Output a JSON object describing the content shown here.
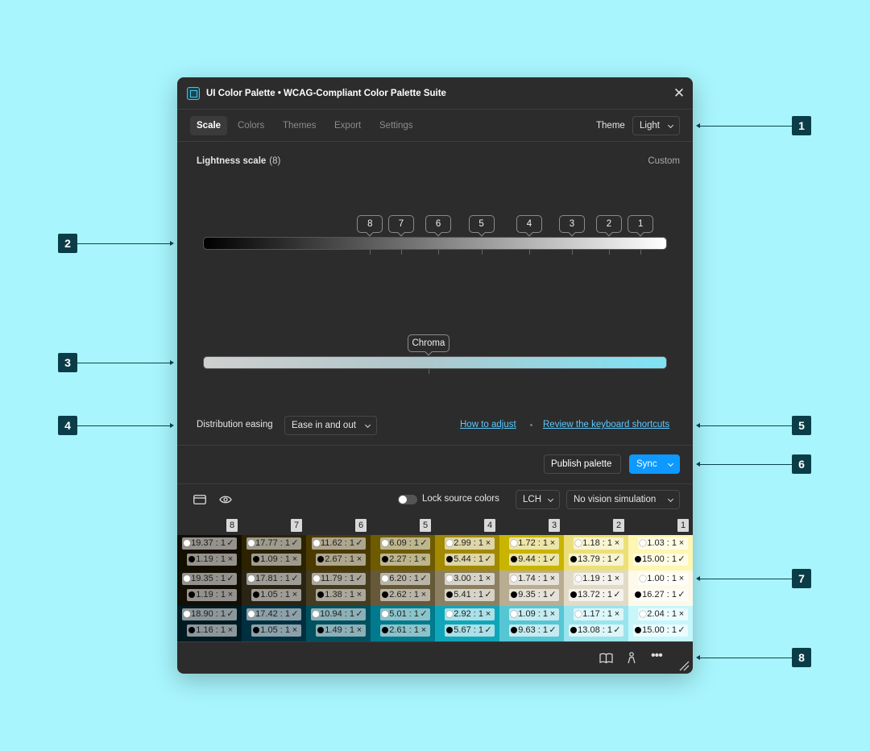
{
  "window": {
    "title": "UI Color Palette • WCAG-Compliant Color Palette Suite"
  },
  "tabs": [
    "Scale",
    "Colors",
    "Themes",
    "Export",
    "Settings"
  ],
  "theme": {
    "label": "Theme",
    "value": "Light"
  },
  "scale": {
    "title": "Lightness scale",
    "count": "(8)",
    "mode": "Custom",
    "stops": [
      {
        "label": "8",
        "lightness_pct": 36
      },
      {
        "label": "7",
        "lightness_pct": 42.7
      },
      {
        "label": "6",
        "lightness_pct": 50.7
      },
      {
        "label": "5",
        "lightness_pct": 60
      },
      {
        "label": "4",
        "lightness_pct": 70.3
      },
      {
        "label": "3",
        "lightness_pct": 79.5
      },
      {
        "label": "2",
        "lightness_pct": 87.5
      },
      {
        "label": "1",
        "lightness_pct": 94.3
      }
    ],
    "chroma_label": "Chroma",
    "chroma_pct": 48.6
  },
  "easing": {
    "label": "Distribution easing",
    "value": "Ease in and out"
  },
  "links": {
    "how_to_adjust": "How to adjust",
    "shortcuts": "Review the keyboard shortcuts"
  },
  "actions": {
    "publish": "Publish palette",
    "sync": "Sync"
  },
  "toolbar": {
    "lock_label": "Lock source colors",
    "color_space": "LCH",
    "vision": "No vision simulation"
  },
  "palette": {
    "columns": [
      "8",
      "7",
      "6",
      "5",
      "4",
      "3",
      "2",
      "1"
    ],
    "rows": [
      {
        "colors": [
          "#140e00",
          "#2b2200",
          "#4a3a00",
          "#6e5b00",
          "#a28900",
          "#c9b400",
          "#ecdf7a",
          "#fef6b3"
        ],
        "white": [
          [
            "19.37 : 1",
            "pass"
          ],
          [
            "17.77 : 1",
            "pass"
          ],
          [
            "11.62 : 1",
            "pass"
          ],
          [
            "6.09 : 1",
            "pass"
          ],
          [
            "2.99 : 1",
            "fail"
          ],
          [
            "1.72 : 1",
            "fail"
          ],
          [
            "1.18 : 1",
            "fail"
          ],
          [
            "1.03 : 1",
            "fail"
          ]
        ],
        "black": [
          [
            "1.19 : 1",
            "fail"
          ],
          [
            "1.09 : 1",
            "fail"
          ],
          [
            "2.67 : 1",
            "fail"
          ],
          [
            "2.27 : 1",
            "fail"
          ],
          [
            "5.44 : 1",
            "pass"
          ],
          [
            "9.44 : 1",
            "pass"
          ],
          [
            "13.79 : 1",
            "pass"
          ],
          [
            "15.00 : 1",
            "pass"
          ]
        ]
      },
      {
        "colors": [
          "#130f05",
          "#2a2415",
          "#463c20",
          "#66593a",
          "#8d8062",
          "#b8ad92",
          "#e0dac7",
          "#fdfae9"
        ],
        "white": [
          [
            "19.35 : 1",
            "pass"
          ],
          [
            "17.81 : 1",
            "pass"
          ],
          [
            "11.79 : 1",
            "pass"
          ],
          [
            "6.20 : 1",
            "pass"
          ],
          [
            "3.00 : 1",
            "fail"
          ],
          [
            "1.74 : 1",
            "fail"
          ],
          [
            "1.19 : 1",
            "fail"
          ],
          [
            "1.00 : 1",
            "fail"
          ]
        ],
        "black": [
          [
            "1.19 : 1",
            "fail"
          ],
          [
            "1.05 : 1",
            "fail"
          ],
          [
            "1.38 : 1",
            "fail"
          ],
          [
            "2.62 : 1",
            "fail"
          ],
          [
            "5.41 : 1",
            "pass"
          ],
          [
            "9.35 : 1",
            "pass"
          ],
          [
            "13.72 : 1",
            "pass"
          ],
          [
            "16.27 : 1",
            "pass"
          ]
        ]
      },
      {
        "colors": [
          "#001a22",
          "#003040",
          "#00505f",
          "#007a8c",
          "#10a6ba",
          "#56c6d4",
          "#9ae4ed",
          "#c8f6fb"
        ],
        "white": [
          [
            "18.90 : 1",
            "pass"
          ],
          [
            "17.42 : 1",
            "pass"
          ],
          [
            "10.94 : 1",
            "pass"
          ],
          [
            "5.01 : 1",
            "pass"
          ],
          [
            "2.92 : 1",
            "fail"
          ],
          [
            "1.09 : 1",
            "fail"
          ],
          [
            "1.17 : 1",
            "fail"
          ],
          [
            "2.04 : 1",
            "fail"
          ]
        ],
        "black": [
          [
            "1.16 : 1",
            "fail"
          ],
          [
            "1.05 : 1",
            "fail"
          ],
          [
            "1.49 : 1",
            "fail"
          ],
          [
            "2.61 : 1",
            "fail"
          ],
          [
            "5.67 : 1",
            "pass"
          ],
          [
            "9.63 : 1",
            "pass"
          ],
          [
            "13.08 : 1",
            "pass"
          ],
          [
            "15.00 : 1",
            "pass"
          ]
        ]
      }
    ]
  },
  "callouts": [
    "1",
    "2",
    "3",
    "4",
    "5",
    "6",
    "7",
    "8"
  ],
  "colors": {
    "accent": "#0d99ff",
    "link": "#5cc9ff",
    "callout": "#0b3d48",
    "background": "#a8f5fd"
  }
}
